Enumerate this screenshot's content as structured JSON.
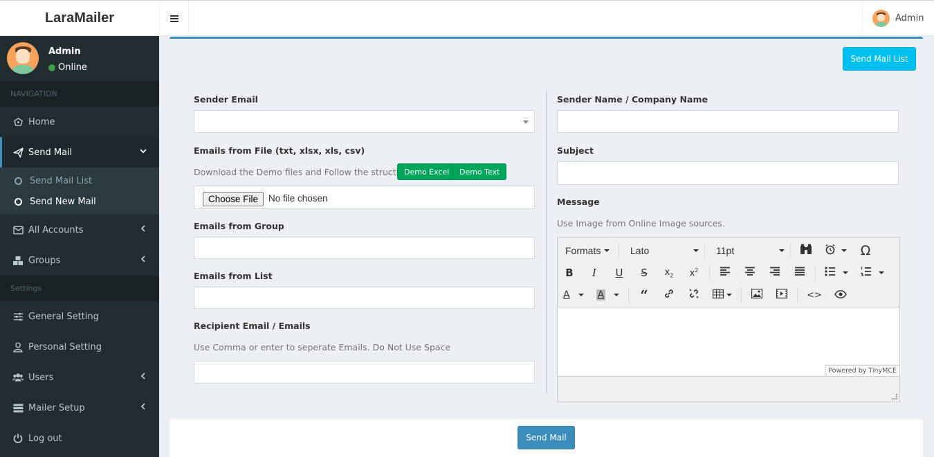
{
  "app": {
    "title": "LaraMailer"
  },
  "topbar": {
    "user_name": "Admin"
  },
  "sidebar": {
    "user": {
      "name": "Admin",
      "status": "Online"
    },
    "section_navigation": "NAVIGATION",
    "section_settings": "Settings",
    "items": {
      "home": "Home",
      "send_mail": "Send Mail",
      "send_mail_list": "Send Mail List",
      "send_new_mail": "Send New Mail",
      "all_accounts": "All Accounts",
      "groups": "Groups",
      "general_setting": "General Setting",
      "personal_setting": "Personal Setting",
      "users": "Users",
      "mailer_setup": "Mailer Setup",
      "log_out": "Log out"
    }
  },
  "form": {
    "send_mail_list_button": "Send Mail List",
    "sender_email_label": "Sender Email",
    "emails_from_file_label": "Emails from File (txt, xlsx, xls, csv)",
    "emails_from_file_help": "Download the Demo files and Follow the structure",
    "demo_excel_button": "Demo Excel",
    "demo_text_button": "Demo Text",
    "choose_file_button": "Choose File",
    "no_file_text": "No file chosen",
    "emails_from_group_label": "Emails from Group",
    "emails_from_list_label": "Emails from List",
    "recipient_label": "Recipient Email / Emails",
    "recipient_help": "Use Comma or enter to seperate Emails. Do Not Use Space",
    "sender_name_label": "Sender Name / Company Name",
    "subject_label": "Subject",
    "message_label": "Message",
    "message_help": "Use Image from Online Image sources.",
    "send_mail_button": "Send Mail"
  },
  "editor": {
    "formats": "Formats",
    "font": "Lato",
    "font_size": "11pt",
    "powered_by": "Powered by TinyMCE"
  },
  "colors": {
    "primary": "#3c8dbc",
    "info": "#00c0ef",
    "success": "#00a65a",
    "sidebar": "#222d32"
  }
}
